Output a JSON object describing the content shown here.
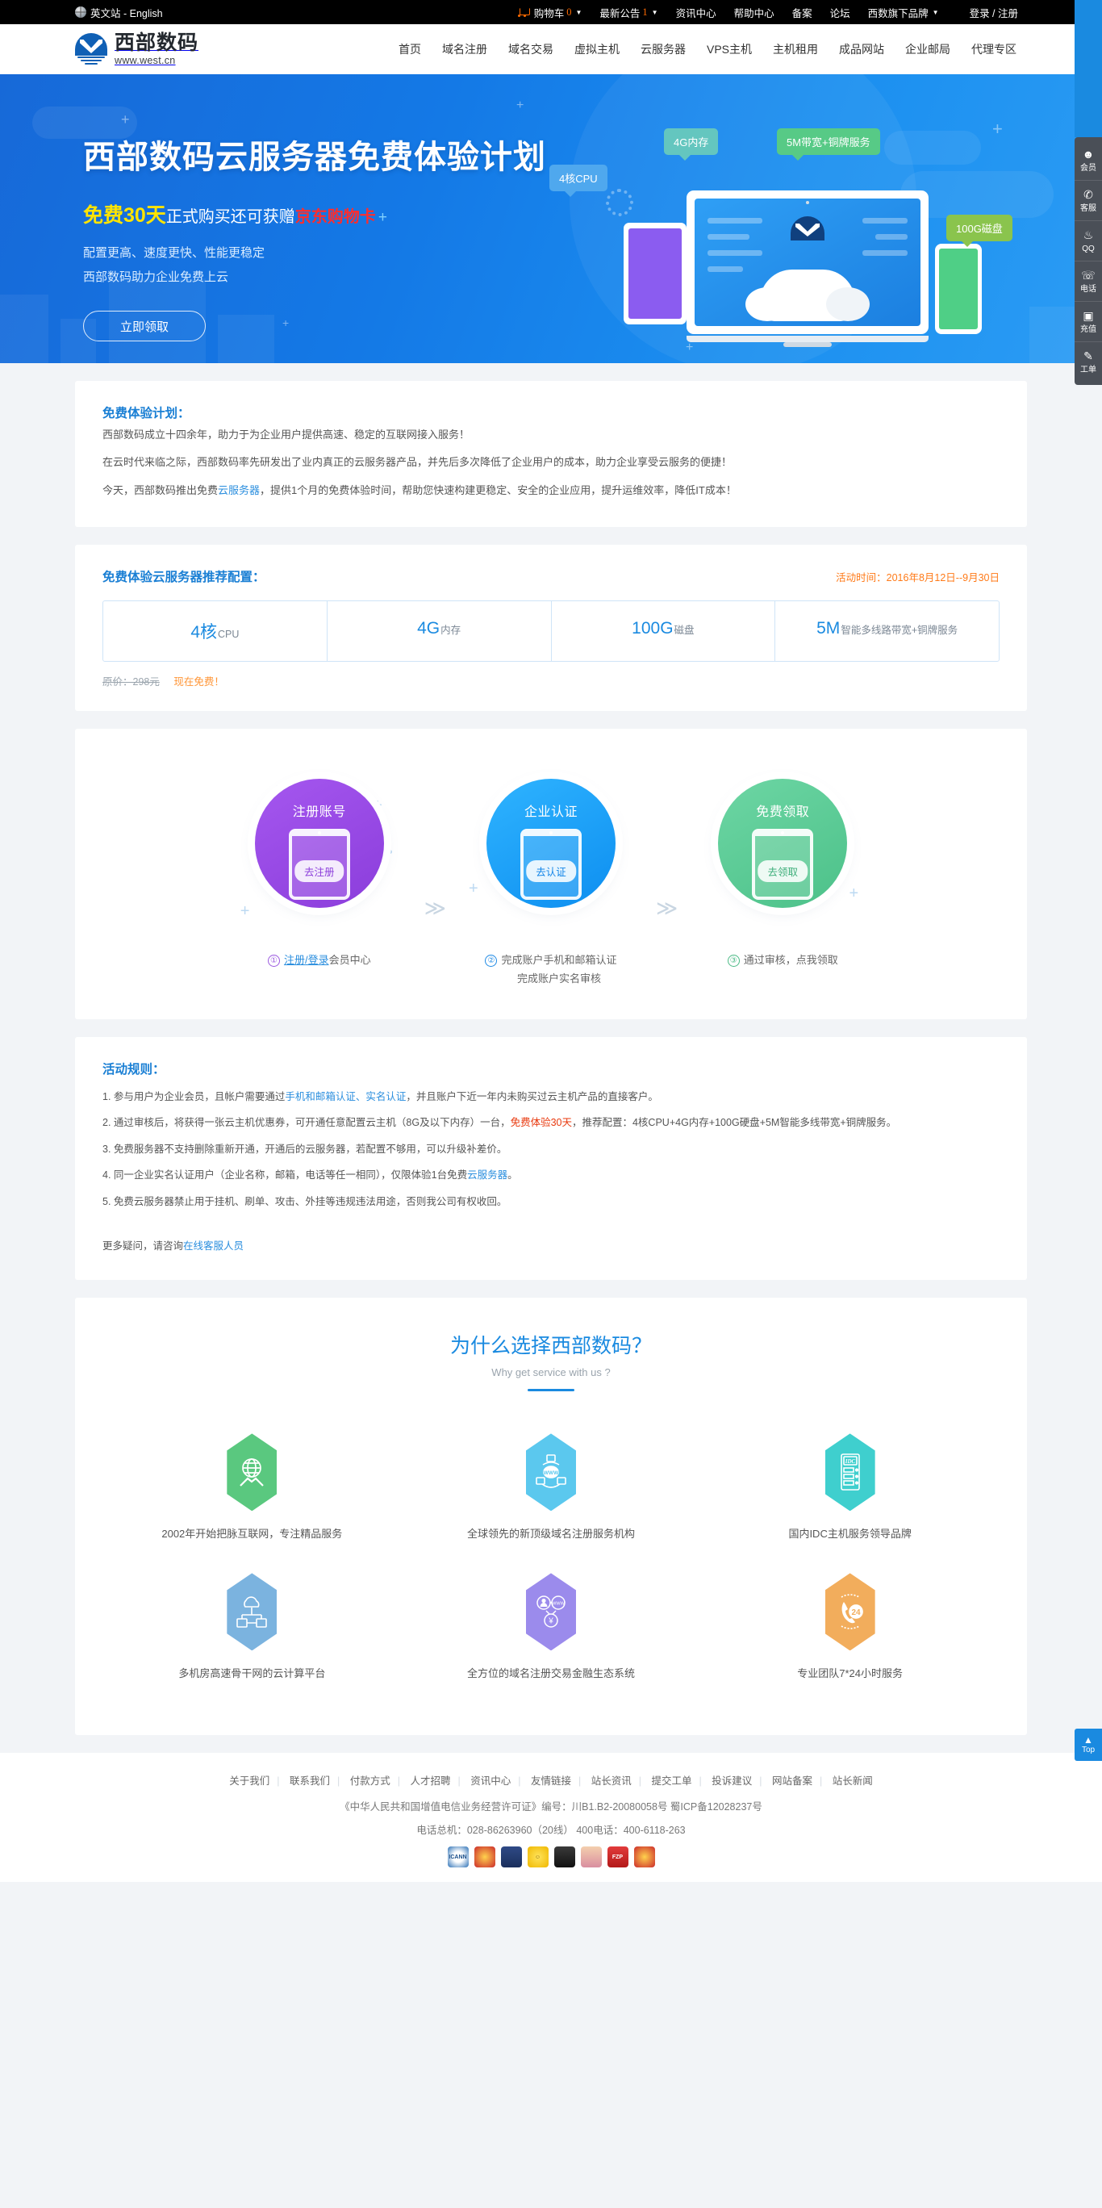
{
  "topbar": {
    "lang_label": "英文站 - English",
    "cart_label": "购物车",
    "cart_count": "0",
    "notice_label": "最新公告",
    "notice_count": "1",
    "items": [
      "资讯中心",
      "帮助中心",
      "备案",
      "论坛"
    ],
    "brands_label": "西数旗下品牌",
    "login_label": "登录 / 注册"
  },
  "header": {
    "logo_cn": "西部数码",
    "logo_en": "www.west.cn",
    "nav": [
      "首页",
      "域名注册",
      "域名交易",
      "虚拟主机",
      "云服务器",
      "VPS主机",
      "主机租用",
      "成品网站",
      "企业邮局",
      "代理专区"
    ]
  },
  "hero": {
    "title": "西部数码云服务器免费体验计划",
    "sub_yellow": "免费30天",
    "sub_white": "正式购买还可获赠",
    "sub_red": "京东购物卡",
    "sub_plus": "+",
    "desc_line1": "配置更高、速度更快、性能更稳定",
    "desc_line2": "西部数码助力企业免费上云",
    "cta_label": "立即领取",
    "tags": {
      "cpu": "4核CPU",
      "ram": "4G内存",
      "bandwidth": "5M带宽+铜牌服务",
      "disk": "100G磁盘"
    }
  },
  "intro": {
    "title": "免费体验计划：",
    "p1": "西部数码成立十四余年，助力于为企业用户提供高速、稳定的互联网接入服务！",
    "p2": "在云时代来临之际，西部数码率先研发出了业内真正的云服务器产品，并先后多次降低了企业用户的成本，助力企业享受云服务的便捷！",
    "p3_a": "今天，西部数码推出免费",
    "p3_link": "云服务器",
    "p3_b": "，提供1个月的免费体验时间，帮助您快速构建更稳定、安全的企业应用，提升运维效率，降低IT成本！"
  },
  "config": {
    "title": "免费体验云服务器推荐配置：",
    "date_label": "活动时间：",
    "date_value": "2016年8月12日--9月30日",
    "cells": [
      {
        "num": "4核",
        "unit": "CPU"
      },
      {
        "num": "4G",
        "unit": "内存"
      },
      {
        "num": "100G",
        "unit": "磁盘"
      },
      {
        "num": "5M",
        "unit": "智能多线路带宽+铜牌服务"
      }
    ],
    "price_old": "原价：298元",
    "price_free": "现在免费！"
  },
  "steps": [
    {
      "circle_label": "注册账号",
      "go_label": "去注册",
      "num": "①",
      "caption_link": "注册/登录",
      "caption_text": "会员中心",
      "caption_line2": ""
    },
    {
      "circle_label": "企业认证",
      "go_label": "去认证",
      "num": "②",
      "caption_link": "完成账户手机和邮箱认证",
      "caption_text": "",
      "caption_line2": "完成账户实名审核"
    },
    {
      "circle_label": "免费领取",
      "go_label": "去领取",
      "num": "③",
      "caption_link": "通过审核，点我领取",
      "caption_text": "",
      "caption_line2": ""
    }
  ],
  "steps_separator": "≫",
  "rules": {
    "title": "活动规则：",
    "items": [
      {
        "pre": "1. 参与用户为企业会员，且帐户需要通过",
        "link1": "手机和邮箱认证、实名认证",
        "post": "，并且账户下近一年内未购买过云主机产品的直接客户。"
      },
      {
        "pre": "2. 通过审核后，将获得一张云主机优惠券，可开通任意配置云主机（8G及以下内存）一台，",
        "red": "免费体验30天",
        "post": "，推荐配置：4核CPU+4G内存+100G硬盘+5M智能多线带宽+铜牌服务。"
      },
      {
        "pre": "3. 免费服务器不支持删除重新开通，开通后的云服务器，若配置不够用，可以升级补差价。",
        "post": ""
      },
      {
        "pre": "4. 同一企业实名认证用户（企业名称，邮箱，电话等任一相同），仅限体验1台免费",
        "link1": "云服务器",
        "post": "。"
      },
      {
        "pre": "5. 免费云服务器禁止用于挂机、刷单、攻击、外挂等违规违法用途，否则我公司有权收回。",
        "post": ""
      }
    ],
    "more_pre": "更多疑问，请咨询",
    "more_link": "在线客服人员"
  },
  "why": {
    "title": "为什么选择西部数码？",
    "subtitle": "Why get service with us ?",
    "items": [
      {
        "caption": "2002年开始把脉互联网，专注精品服务",
        "color": "#5ac87f",
        "icon": "globe-hands-icon"
      },
      {
        "caption": "全球领先的新顶级域名注册服务机构",
        "color": "#5bc8ee",
        "icon": "www-network-icon"
      },
      {
        "caption": "国内IDC主机服务领导品牌",
        "color": "#3fcfce",
        "icon": "idc-server-icon"
      },
      {
        "caption": "多机房高速骨干网的云计算平台",
        "color": "#7bb3df",
        "icon": "cloud-nodes-icon"
      },
      {
        "caption": "全方位的域名注册交易金融生态系统",
        "color": "#9b8bec",
        "icon": "user-www-yuan-icon"
      },
      {
        "caption": "专业团队7*24小时服务",
        "color": "#f2ad5c",
        "icon": "phone-24-icon"
      }
    ]
  },
  "footer": {
    "links": [
      "关于我们",
      "联系我们",
      "付款方式",
      "人才招聘",
      "资讯中心",
      "友情链接",
      "站长资讯",
      "提交工单",
      "投诉建议",
      "网站备案",
      "站长新闻"
    ],
    "license": "《中华人民共和国增值电信业务经营许可证》编号：川B1.B2-20080058号  蜀ICP备12028237号",
    "phone_line": "电话总机：028-86263960（20线）     400电话：400-6118-263",
    "badges": [
      "ICANN",
      "国徽",
      "警察",
      "笑脸",
      "QQ",
      "双人",
      "FZP",
      "国徽2"
    ]
  },
  "rail": {
    "items": [
      {
        "icon": "user-icon",
        "label": "会员"
      },
      {
        "icon": "headset-icon",
        "label": "客服"
      },
      {
        "icon": "qq-icon",
        "label": "QQ"
      },
      {
        "icon": "phone-icon",
        "label": "电话"
      },
      {
        "icon": "gift-icon",
        "label": "充值"
      },
      {
        "icon": "ticket-icon",
        "label": "工单"
      }
    ],
    "top_label": "Top",
    "top_arrow": "▲"
  }
}
